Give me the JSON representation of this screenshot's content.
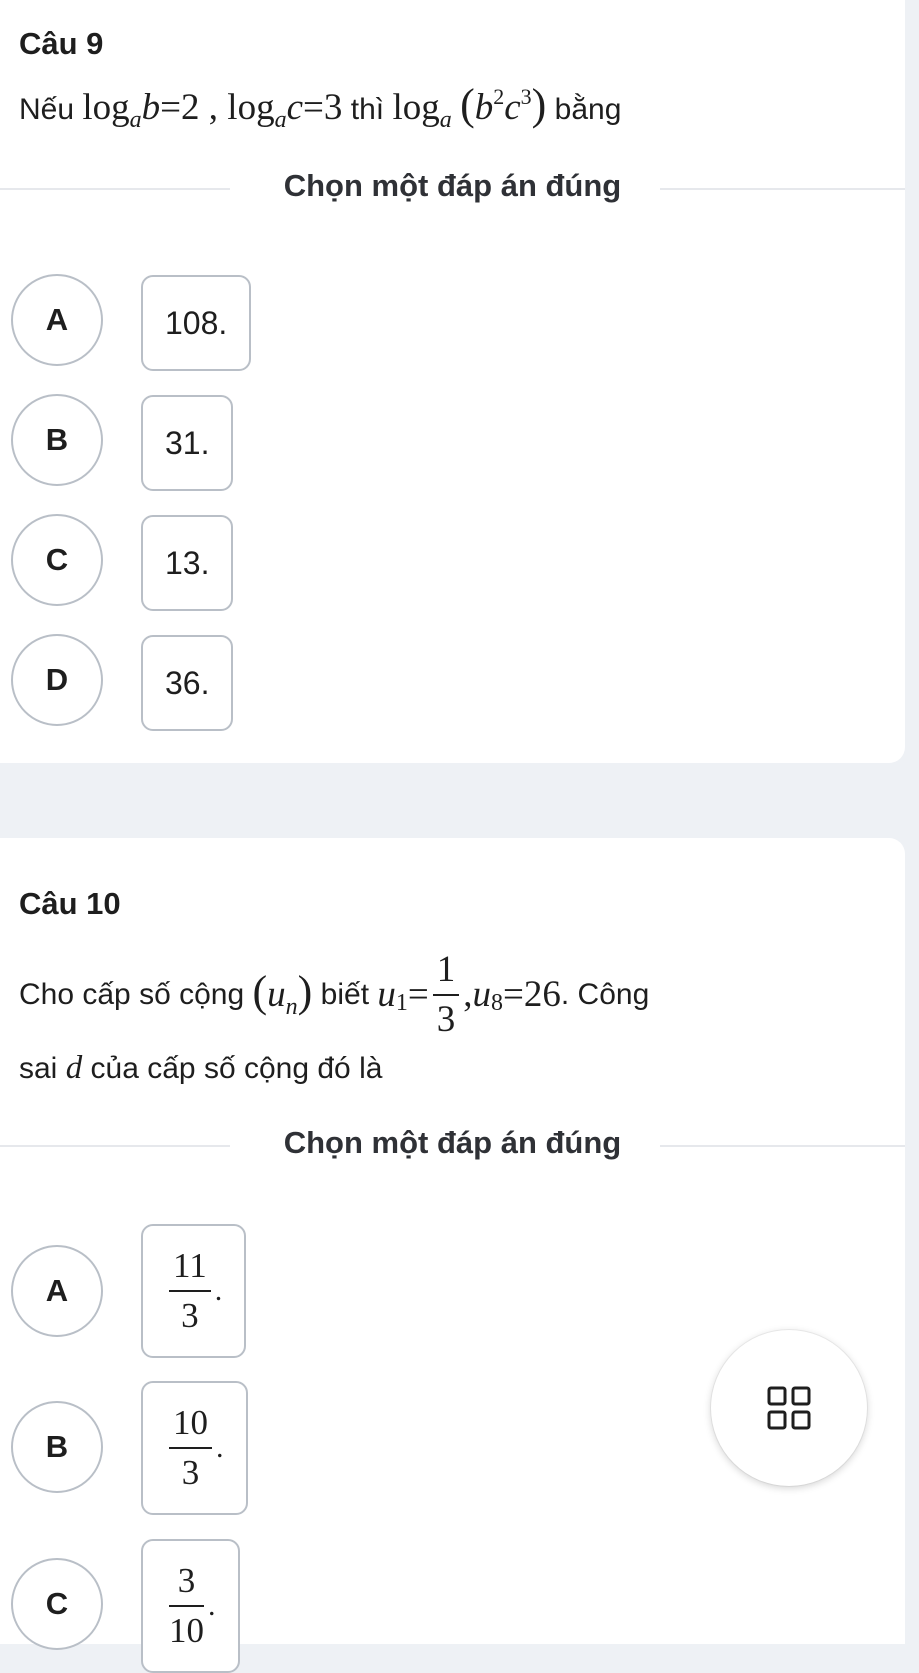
{
  "q9": {
    "title": "Câu 9",
    "prefix": "Nếu",
    "then_word": "thì",
    "suffix": "bằng",
    "divider_label": "Chọn một đáp án đúng",
    "options": [
      {
        "letter": "A",
        "text": "108."
      },
      {
        "letter": "B",
        "text": "31."
      },
      {
        "letter": "C",
        "text": "13."
      },
      {
        "letter": "D",
        "text": "36."
      }
    ]
  },
  "q10": {
    "title": "Câu 10",
    "line1_prefix": "Cho cấp số cộng",
    "line1_knows": "biết",
    "line1_suffix": ". Công",
    "line2_prefix": "sai",
    "line2_var": "d",
    "line2_suffix": "của cấp số cộng đó là",
    "divider_label": "Chọn một đáp án đúng",
    "options": [
      {
        "letter": "A",
        "num": "11",
        "den": "3"
      },
      {
        "letter": "B",
        "num": "10",
        "den": "3"
      },
      {
        "letter": "C",
        "num": "3",
        "den": "10"
      }
    ]
  },
  "fab": {
    "icon": "grid-icon"
  }
}
